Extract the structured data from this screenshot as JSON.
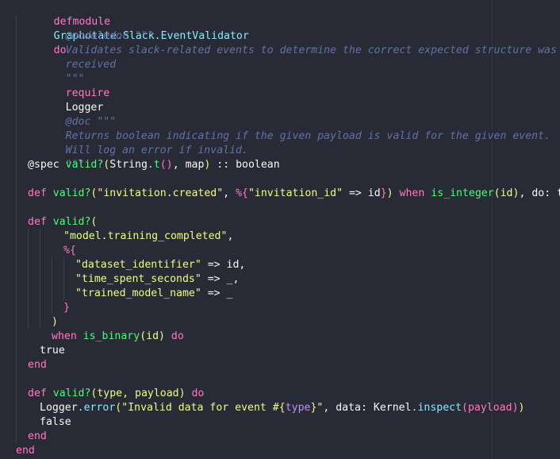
{
  "colors": {
    "background": "#282a36",
    "keyword": "#ff79c6",
    "module": "#8be9fd",
    "function": "#50fa7b",
    "string": "#f1fa8c",
    "comment": "#6272a4",
    "text": "#f8f8f2"
  },
  "code": {
    "l1": {
      "kw": "defmodule",
      "mod": "Graphotate.Slack.EventValidator",
      "do": "do"
    },
    "l2": {
      "text": "@moduledoc \"\"\""
    },
    "l3": {
      "text": "Validates slack-related events to determine the correct expected structure was"
    },
    "l4": {
      "text": "received"
    },
    "l5": {
      "text": "\"\"\""
    },
    "l6": {
      "kw": "require",
      "mod": "Logger"
    },
    "l8": {
      "text": "@doc \"\"\""
    },
    "l9": {
      "text": "Returns boolean indicating if the given payload is valid for the given event."
    },
    "l10": {
      "text": "Will log an error if invalid."
    },
    "l11": {
      "text": "\"\"\""
    },
    "l12": {
      "attr": "@spec",
      "fn": "valid?",
      "open": "(",
      "mod": "String",
      "dot": ".",
      "call": "t",
      "args": "()",
      "rest": ", map",
      "close": ")",
      "tail": " :: boolean"
    },
    "l14": {
      "kw": "def",
      "fn": "valid?",
      "open": "(",
      "str1": "\"invitation.created\"",
      "sep": ", ",
      "map_open": "%{",
      "str2": "\"invitation_id\"",
      "arrow": " => id",
      "map_close": "}",
      "close": ")",
      "when": "when",
      "guard": "is_integer",
      "guard_args": "(id)",
      "tail": ", do: true"
    },
    "l16": {
      "kw": "def",
      "fn": "valid?",
      "open": "("
    },
    "l17": {
      "str": "\"model.training_completed\"",
      "tail": ","
    },
    "l18": {
      "text": "%{"
    },
    "l19": {
      "str": "\"dataset_identifier\"",
      "tail": " => id,"
    },
    "l20": {
      "str": "\"time_spent_seconds\"",
      "tail": " => _,"
    },
    "l21": {
      "str": "\"trained_model_name\"",
      "tail": " => _"
    },
    "l22": {
      "text": "}"
    },
    "l23": {
      "text": ")"
    },
    "l24": {
      "when": "when",
      "fn": "is_binary",
      "args": "(id)",
      "do": "do"
    },
    "l25": {
      "text": "true"
    },
    "l26": {
      "text": "end"
    },
    "l28": {
      "kw": "def",
      "fn": "valid?",
      "args": "(type, payload)",
      "do": "do"
    },
    "l29": {
      "mod": "Logger",
      "dot": ".",
      "fn": "error",
      "open": "(",
      "str1": "\"Invalid data for event #{",
      "interp": "type",
      "str2": "}\"",
      "mid": ", data: ",
      "mod2": "Kernel",
      "dot2": ".",
      "fn2": "inspect",
      "args2": "(payload)",
      "close": ")"
    },
    "l30": {
      "text": "false"
    },
    "l31": {
      "text": "end"
    },
    "l32": {
      "text": "end"
    }
  }
}
